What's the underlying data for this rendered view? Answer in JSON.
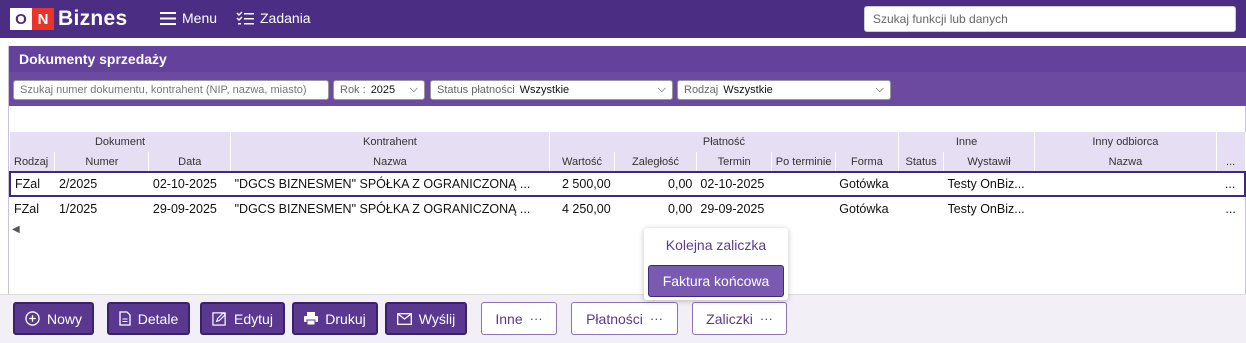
{
  "topbar": {
    "logo_on": "O",
    "logo_n": "N",
    "logo_text": "Biznes",
    "menu_label": "Menu",
    "tasks_label": "Zadania",
    "search_placeholder": "Szukaj funkcji lub danych"
  },
  "panel": {
    "title": "Dokumenty sprzedaży",
    "filters": {
      "search_placeholder": "Szukaj  numer dokumentu, kontrahent (NIP, nazwa, miasto)",
      "year_label": "Rok :",
      "year_value": "2025",
      "status_label": "Status płatności",
      "status_value": "Wszystkie",
      "type_label": "Rodzaj",
      "type_value": "Wszystkie"
    }
  },
  "table": {
    "groups": [
      "Dokument",
      "Kontrahent",
      "Płatność",
      "Inne",
      "Inny odbiorca"
    ],
    "columns": [
      "Rodzaj",
      "Numer",
      "Data",
      "Nazwa",
      "Wartość",
      "Zaległość",
      "Termin",
      "Po terminie",
      "Forma",
      "Status",
      "Wystawił",
      "Nazwa",
      "..."
    ],
    "rows": [
      [
        "FZal",
        "2/2025",
        "02-10-2025",
        "\"DGCS BIZNESMEN\" SPÓŁKA Z OGRANICZONĄ ...",
        "2 500,00",
        "0,00",
        "02-10-2025",
        "",
        "Gotówka",
        "",
        "Testy OnBiz...",
        "",
        "..."
      ],
      [
        "FZal",
        "1/2025",
        "29-09-2025",
        "\"DGCS BIZNESMEN\" SPÓŁKA Z OGRANICZONĄ ...",
        "4 250,00",
        "0,00",
        "29-09-2025",
        "",
        "Gotówka",
        "",
        "Testy OnBiz...",
        "",
        "..."
      ]
    ]
  },
  "popup": {
    "item1": "Kolejna zaliczka",
    "item2": "Faktura końcowa"
  },
  "buttons": {
    "new": "Nowy",
    "details": "Detale",
    "edit": "Edytuj",
    "print": "Drukuj",
    "send": "Wyślij",
    "other": "Inne",
    "payments": "Płatności",
    "advances": "Zaliczki"
  },
  "colors": {
    "topbar": "#4b2d83",
    "accent": "#5a3890",
    "header_row": "#e6def2"
  }
}
